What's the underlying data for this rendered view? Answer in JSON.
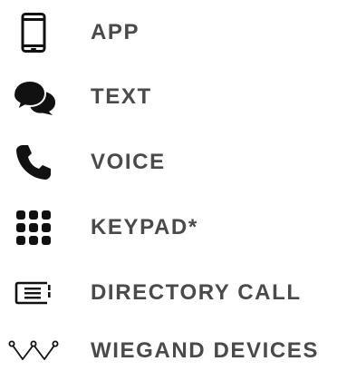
{
  "features": [
    {
      "label": "APP",
      "icon": "smartphone-icon"
    },
    {
      "label": "TEXT",
      "icon": "chat-bubbles-icon"
    },
    {
      "label": "VOICE",
      "icon": "phone-handset-icon"
    },
    {
      "label": "KEYPAD*",
      "icon": "keypad-grid-icon"
    },
    {
      "label": "DIRECTORY CALL",
      "icon": "directory-list-icon"
    },
    {
      "label": "WIEGAND DEVICES",
      "icon": "wiegand-wave-icon"
    }
  ],
  "colors": {
    "icon": "#111111",
    "text": "#4a4a4a",
    "background": "#ffffff"
  }
}
